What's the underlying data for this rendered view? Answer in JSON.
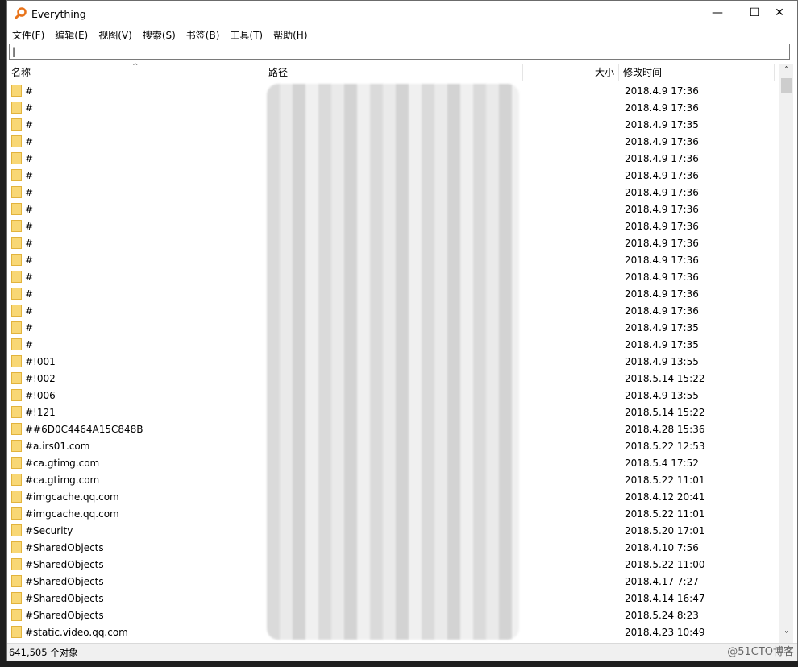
{
  "window": {
    "title": "Everything",
    "minimize": "—",
    "maximize": "☐",
    "close": "✕",
    "accent": "#e8731a"
  },
  "menu": [
    "文件(F)",
    "编辑(E)",
    "视图(V)",
    "搜索(S)",
    "书签(B)",
    "工具(T)",
    "帮助(H)"
  ],
  "search": {
    "value": "",
    "placeholder": ""
  },
  "columns": {
    "name": "名称",
    "path": "路径",
    "size": "大小",
    "modified": "修改时间"
  },
  "rows": [
    {
      "name": "#",
      "date": "2018.4.9 17:36"
    },
    {
      "name": "#",
      "date": "2018.4.9 17:36"
    },
    {
      "name": "#",
      "date": "2018.4.9 17:35"
    },
    {
      "name": "#",
      "date": "2018.4.9 17:36"
    },
    {
      "name": "#",
      "date": "2018.4.9 17:36"
    },
    {
      "name": "#",
      "date": "2018.4.9 17:36"
    },
    {
      "name": "#",
      "date": "2018.4.9 17:36"
    },
    {
      "name": "#",
      "date": "2018.4.9 17:36"
    },
    {
      "name": "#",
      "date": "2018.4.9 17:36"
    },
    {
      "name": "#",
      "date": "2018.4.9 17:36"
    },
    {
      "name": "#",
      "date": "2018.4.9 17:36"
    },
    {
      "name": "#",
      "date": "2018.4.9 17:36"
    },
    {
      "name": "#",
      "date": "2018.4.9 17:36"
    },
    {
      "name": "#",
      "date": "2018.4.9 17:36"
    },
    {
      "name": "#",
      "date": "2018.4.9 17:35"
    },
    {
      "name": "#",
      "date": "2018.4.9 17:35"
    },
    {
      "name": "#!001",
      "date": "2018.4.9 13:55"
    },
    {
      "name": "#!002",
      "date": "2018.5.14 15:22"
    },
    {
      "name": "#!006",
      "date": "2018.4.9 13:55"
    },
    {
      "name": "#!121",
      "date": "2018.5.14 15:22"
    },
    {
      "name": "##6D0C4464A15C848B",
      "date": "2018.4.28 15:36"
    },
    {
      "name": "#a.irs01.com",
      "date": "2018.5.22 12:53"
    },
    {
      "name": "#ca.gtimg.com",
      "date": "2018.5.4 17:52"
    },
    {
      "name": "#ca.gtimg.com",
      "date": "2018.5.22 11:01"
    },
    {
      "name": "#imgcache.qq.com",
      "date": "2018.4.12 20:41"
    },
    {
      "name": "#imgcache.qq.com",
      "date": "2018.5.22 11:01"
    },
    {
      "name": "#Security",
      "date": "2018.5.20 17:01"
    },
    {
      "name": "#SharedObjects",
      "date": "2018.4.10 7:56"
    },
    {
      "name": "#SharedObjects",
      "date": "2018.5.22 11:00"
    },
    {
      "name": "#SharedObjects",
      "date": "2018.4.17 7:27"
    },
    {
      "name": "#SharedObjects",
      "date": "2018.4.14 16:47"
    },
    {
      "name": "#SharedObjects",
      "date": "2018.5.24 8:23"
    },
    {
      "name": "#static.video.qq.com",
      "date": "2018.4.23 10:49"
    }
  ],
  "status": {
    "count": "641,505 个对象",
    "watermark": "@51CTO博客"
  }
}
